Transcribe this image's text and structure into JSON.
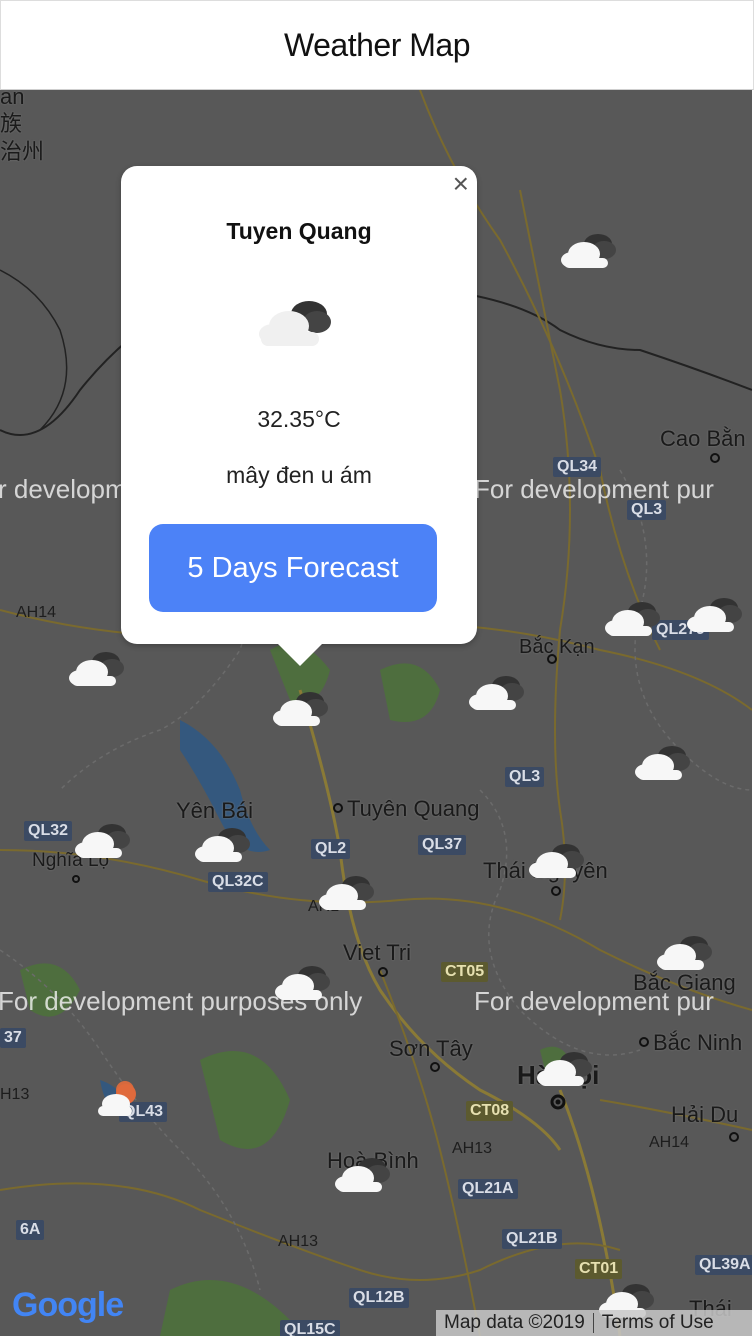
{
  "header": {
    "title": "Weather Map"
  },
  "popup": {
    "city": "Tuyen Quang",
    "temperature": "32.35°C",
    "description": "mây đen u ám",
    "forecast_button": "5 Days Forecast",
    "close_symbol": "×",
    "icon": "overcast-cloud-icon"
  },
  "map": {
    "watermark": "For development purposes only",
    "watermark_right": "For development pur",
    "watermark_left": "r development",
    "places": {
      "cao_bang": "Cao Bằn",
      "bac_kan": "Bắc Kạn",
      "yen_bai": "Yên Bái",
      "tuyen_quang": "Tuyên Quang",
      "nghia_lo": "Nghĩa Lộ",
      "thai_nguyen": "Thái Nguyên",
      "viet_tri": "Viet Tri",
      "bac_giang": "Bắc Giang",
      "son_tay": "Sơn Tây",
      "bac_ninh": "Bắc Ninh",
      "hanoi": "Hà Nội",
      "hai_duong": "Hải Du",
      "hoa_binh": "Hoà Bình",
      "thai_binh": "Thái",
      "cjk1": "an",
      "cjk2": "族",
      "cjk3": "治州"
    },
    "roads": [
      "QL34",
      "QL3",
      "QL279",
      "QL3",
      "QL32",
      "QL2",
      "QL37",
      "QL32C",
      "CT05",
      "CT08",
      "QL43",
      "QL21A",
      "QL21B",
      "CT01",
      "QL39A",
      "QL12B",
      "QL15C",
      "6A",
      "37"
    ],
    "highways": [
      "AH14",
      "AH14",
      "AH13",
      "AH13",
      "H13",
      "AH1"
    ]
  },
  "attribution": {
    "logo": "Google",
    "map_data": "Map data ©2019",
    "terms": "Terms of Use"
  }
}
